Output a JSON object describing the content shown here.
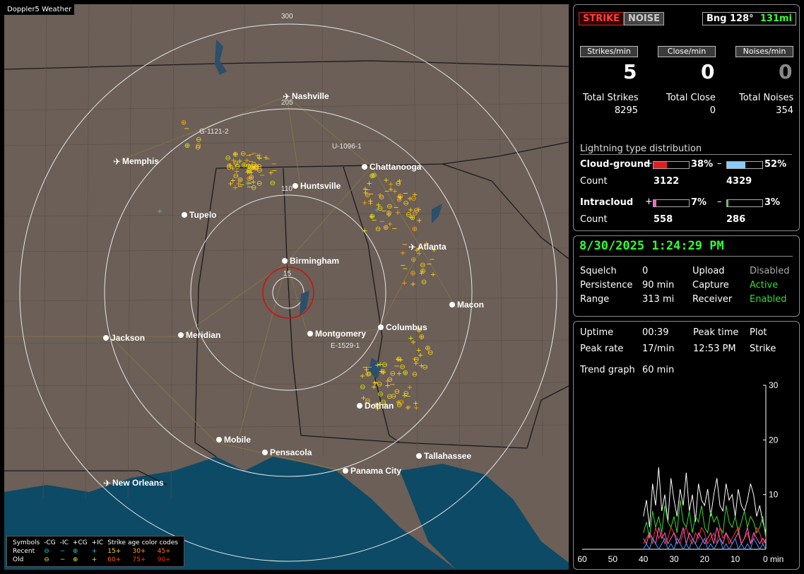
{
  "app": {
    "title": "Doppler5 Weather"
  },
  "map": {
    "cities": [
      {
        "name": "Nashville",
        "airport": true
      },
      {
        "name": "Memphis",
        "airport": true
      },
      {
        "name": "Chattanooga",
        "airport": false
      },
      {
        "name": "Huntsville",
        "airport": false
      },
      {
        "name": "Tupelo",
        "airport": false
      },
      {
        "name": "Birmingham",
        "airport": false
      },
      {
        "name": "Atlanta",
        "airport": true
      },
      {
        "name": "Macon",
        "airport": false
      },
      {
        "name": "Jackson",
        "airport": false
      },
      {
        "name": "Meridian",
        "airport": false
      },
      {
        "name": "Montgomery",
        "airport": false
      },
      {
        "name": "Columbus",
        "airport": false
      },
      {
        "name": "Dothan",
        "airport": false
      },
      {
        "name": "Mobile",
        "airport": false
      },
      {
        "name": "Pensacola",
        "airport": false
      },
      {
        "name": "Tallahassee",
        "airport": false
      },
      {
        "name": "Panama City",
        "airport": false
      },
      {
        "name": "New Orleans",
        "airport": true
      }
    ],
    "ring_labels": [
      "300",
      "205",
      "110",
      "15"
    ],
    "storm_labels": [
      "G-1121-2",
      "U-1096-1",
      "E-1529-1"
    ]
  },
  "legend": {
    "header": [
      "Symbols",
      "-CG",
      "-IC",
      "+CG",
      "+IC",
      "Strike age color codes"
    ],
    "recent": {
      "label": "Recent",
      "ages": [
        "15+",
        "30+",
        "45+"
      ]
    },
    "old": {
      "label": "Old",
      "ages": [
        "60+",
        "75+",
        "90+"
      ]
    },
    "colors": {
      "recent_cg": "#21c8c8",
      "old": "#e6e600",
      "age15": "#ffd700",
      "age30": "#ffa500",
      "age45": "#ff7f00",
      "age60": "#ff6000",
      "age75": "#ff4000",
      "age90": "#ff2000"
    }
  },
  "status": {
    "strike_btn": "STRIKE",
    "noise_btn": "NOISE",
    "bearing": "Bng 128°",
    "distance": "131mi"
  },
  "rates": {
    "strikes_label": "Strikes/min",
    "strikes_value": "5",
    "close_label": "Close/min",
    "close_value": "0",
    "noises_label": "Noises/min",
    "noises_value": "0"
  },
  "totals": {
    "strikes_label": "Total Strikes",
    "strikes_value": "8295",
    "close_label": "Total Close",
    "close_value": "0",
    "noises_label": "Total Noises",
    "noises_value": "354"
  },
  "distribution": {
    "title": "Lightning type distribution",
    "cg_label": "Cloud-ground",
    "cg_pos_pct": "38%",
    "cg_pos_fill": 0.38,
    "cg_neg_pct": "52%",
    "cg_neg_fill": 0.52,
    "count_label": "Count",
    "cg_pos_count": "3122",
    "cg_neg_count": "4329",
    "ic_label": "Intracloud",
    "ic_pos_pct": "7%",
    "ic_pos_fill": 0.07,
    "ic_neg_pct": "3%",
    "ic_neg_fill": 0.03,
    "ic_pos_count": "558",
    "ic_neg_count": "286",
    "plus": "+",
    "minus": "–"
  },
  "datetime": "8/30/2025 1:24:29 PM",
  "settings": {
    "squelch_label": "Squelch",
    "squelch_value": "0",
    "persistence_label": "Persistence",
    "persistence_value": "90 min",
    "range_label": "Range",
    "range_value": "313 mi",
    "upload_label": "Upload",
    "upload_value": "Disabled",
    "capture_label": "Capture",
    "capture_value": "Active",
    "receiver_label": "Receiver",
    "receiver_value": "Enabled"
  },
  "stats": {
    "uptime_label": "Uptime",
    "uptime_value": "00:39",
    "peak_time_label": "Peak time",
    "peak_time_value": "12:53 PM",
    "plot_label": "Plot",
    "plot_value": "Strike",
    "peak_rate_label": "Peak rate",
    "peak_rate_value": "17/min",
    "trend_label": "Trend graph",
    "trend_value": "60 min"
  },
  "chart_data": {
    "type": "line",
    "x_ticks": [
      "60",
      "50",
      "40",
      "30",
      "20",
      "10",
      "0 min"
    ],
    "y_ticks": [
      "30",
      "20",
      "10"
    ],
    "ylim": [
      0,
      30
    ],
    "xlim": [
      60,
      0
    ],
    "series": [
      {
        "color": "#ffffff",
        "values": [
          6,
          9,
          4,
          12,
          8,
          15,
          7,
          10,
          5,
          13,
          9,
          6,
          11,
          8,
          14,
          7,
          10,
          5,
          12,
          9,
          8,
          11,
          6,
          10,
          13,
          8,
          7,
          12,
          9,
          10,
          6,
          11,
          8,
          7,
          9,
          12,
          10,
          6,
          8,
          5,
          3
        ]
      },
      {
        "color": "#33dd33",
        "values": [
          3,
          5,
          2,
          7,
          4,
          6,
          3,
          8,
          5,
          4,
          6,
          3,
          9,
          5,
          4,
          7,
          3,
          6,
          5,
          8,
          4,
          3,
          7,
          5,
          6,
          4,
          3,
          8,
          5,
          4,
          6,
          3,
          5,
          7,
          4,
          6,
          5,
          3,
          4,
          6,
          2
        ]
      },
      {
        "color": "#ff3333",
        "values": [
          1,
          2,
          3,
          1,
          4,
          2,
          3,
          1,
          2,
          4,
          3,
          2,
          1,
          3,
          4,
          2,
          1,
          3,
          2,
          4,
          3,
          1,
          2,
          3,
          1,
          4,
          2,
          3,
          1,
          2,
          3,
          4,
          1,
          2,
          3,
          1,
          2,
          4,
          3,
          1,
          2
        ]
      },
      {
        "color": "#ff66cc",
        "values": [
          2,
          1,
          3,
          2,
          1,
          4,
          2,
          3,
          1,
          2,
          3,
          1,
          2,
          4,
          1,
          3,
          2,
          1,
          3,
          2,
          1,
          2,
          3,
          1,
          4,
          2,
          1,
          3,
          2,
          1,
          2,
          3,
          1,
          2,
          4,
          1,
          3,
          2,
          1,
          2,
          1
        ]
      },
      {
        "color": "#4499ff",
        "values": [
          0,
          1,
          0,
          2,
          1,
          0,
          1,
          2,
          0,
          1,
          0,
          2,
          1,
          0,
          1,
          0,
          2,
          1,
          0,
          1,
          2,
          0,
          1,
          0,
          1,
          2,
          0,
          1,
          0,
          1,
          2,
          0,
          1,
          0,
          1,
          0,
          2,
          1,
          0,
          1,
          0
        ]
      }
    ]
  }
}
